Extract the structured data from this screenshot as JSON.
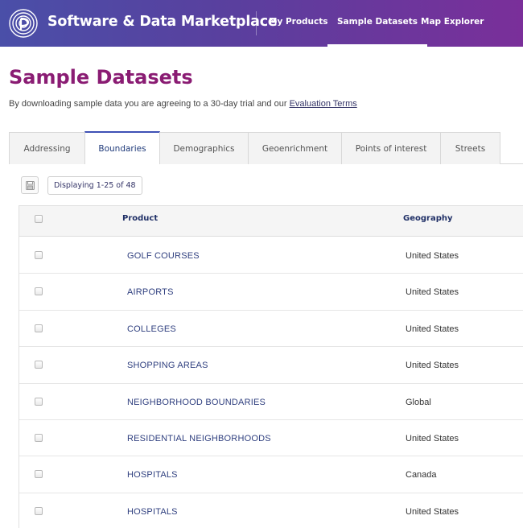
{
  "header": {
    "brand": "Software & Data Marketplace",
    "nav": [
      {
        "label": "My Products"
      },
      {
        "label": "Sample Datasets"
      },
      {
        "label": "Map Explorer"
      }
    ],
    "colors": {
      "gradient_start": "#4a4fa8",
      "gradient_end": "#7a2f9a"
    }
  },
  "page": {
    "title": "Sample Datasets",
    "intro_text": "By downloading sample data you are agreeing to a 30-day trial and our ",
    "intro_link": "Evaluation Terms",
    "title_color": "#8a1c73"
  },
  "tabs": [
    {
      "label": "Addressing"
    },
    {
      "label": "Boundaries"
    },
    {
      "label": "Demographics"
    },
    {
      "label": "Geoenrichment"
    },
    {
      "label": "Points of interest"
    },
    {
      "label": "Streets"
    }
  ],
  "toolbar": {
    "save_icon": "floppy-disk-icon",
    "display_count": "Displaying 1-25 of 48"
  },
  "table": {
    "columns": [
      "Product",
      "Geography"
    ],
    "rows": [
      {
        "product": "GOLF COURSES",
        "geography": "United States"
      },
      {
        "product": "AIRPORTS",
        "geography": "United States"
      },
      {
        "product": "COLLEGES",
        "geography": "United States"
      },
      {
        "product": "SHOPPING AREAS",
        "geography": "United States"
      },
      {
        "product": "NEIGHBORHOOD BOUNDARIES",
        "geography": "Global"
      },
      {
        "product": "RESIDENTIAL NEIGHBORHOODS",
        "geography": "United States"
      },
      {
        "product": "HOSPITALS",
        "geography": "Canada"
      },
      {
        "product": "HOSPITALS",
        "geography": "United States"
      }
    ]
  }
}
